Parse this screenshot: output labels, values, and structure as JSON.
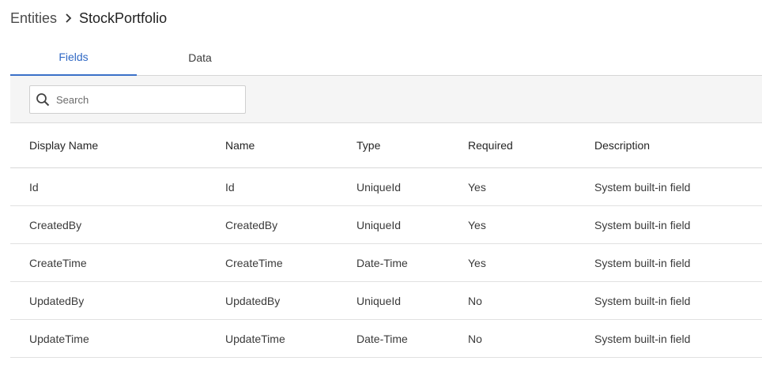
{
  "breadcrumb": {
    "root": "Entities",
    "separator_icon": "chevron-right-icon",
    "current": "StockPortfolio"
  },
  "tabs": [
    {
      "label": "Fields",
      "active": true
    },
    {
      "label": "Data",
      "active": false
    }
  ],
  "search": {
    "icon": "search-icon",
    "placeholder": "Search",
    "value": ""
  },
  "table": {
    "columns": [
      "Display Name",
      "Name",
      "Type",
      "Required",
      "Description"
    ],
    "rows": [
      [
        "Id",
        "Id",
        "UniqueId",
        "Yes",
        "System built-in field"
      ],
      [
        "CreatedBy",
        "CreatedBy",
        "UniqueId",
        "Yes",
        "System built-in field"
      ],
      [
        "CreateTime",
        "CreateTime",
        "Date-Time",
        "Yes",
        "System built-in field"
      ],
      [
        "UpdatedBy",
        "UpdatedBy",
        "UniqueId",
        "No",
        "System built-in field"
      ],
      [
        "UpdateTime",
        "UpdateTime",
        "Date-Time",
        "No",
        "System built-in field"
      ]
    ]
  },
  "colors": {
    "accent": "#2f68c4",
    "toolbar_bg": "#f5f5f5",
    "border": "#e1e1e1"
  }
}
